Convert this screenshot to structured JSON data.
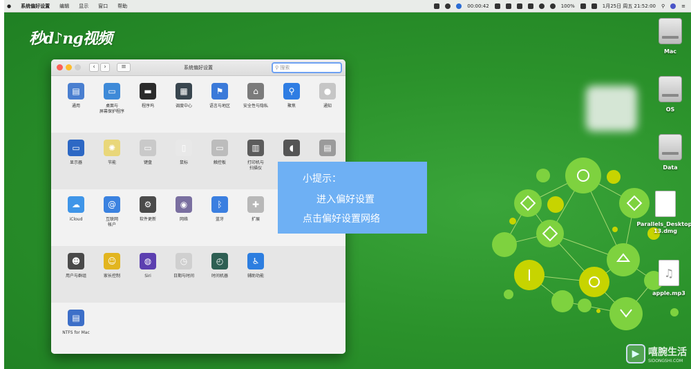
{
  "menubar": {
    "app": "系统偏好设置",
    "menus": [
      "编辑",
      "显示",
      "窗口",
      "帮助"
    ],
    "timer": "00:00:42",
    "battery": "100%",
    "datetime": "1月25日 周五 21:52:00"
  },
  "brand": "秒d♪ng视频",
  "window": {
    "title": "系统偏好设置",
    "search_placeholder": "搜索"
  },
  "rows": [
    [
      {
        "label": "通用",
        "icon": "general-icon",
        "color": "#4a7fd0",
        "glyph": "▤"
      },
      {
        "label": "桌面与\n屏幕保护程序",
        "icon": "desktop-screensaver-icon",
        "color": "#3e8ad8",
        "glyph": "▭"
      },
      {
        "label": "程序坞",
        "icon": "dock-icon",
        "color": "#2b2b2b",
        "glyph": "▬"
      },
      {
        "label": "调度中心",
        "icon": "mission-control-icon",
        "color": "#39464f",
        "glyph": "▦"
      },
      {
        "label": "语言与地区",
        "icon": "language-region-icon",
        "color": "#3b7ad9",
        "glyph": "⚑"
      },
      {
        "label": "安全性与隐私",
        "icon": "security-privacy-icon",
        "color": "#7b7b7b",
        "glyph": "⌂"
      },
      {
        "label": "聚焦",
        "icon": "spotlight-icon",
        "color": "#2f7de3",
        "glyph": "⚲"
      },
      {
        "label": "通知",
        "icon": "notifications-icon",
        "color": "#c6c6c6",
        "glyph": "●"
      }
    ],
    [
      {
        "label": "显示器",
        "icon": "displays-icon",
        "color": "#2d68c4",
        "glyph": "▭"
      },
      {
        "label": "节能",
        "icon": "energy-saver-icon",
        "color": "#e9d77a",
        "glyph": "✺"
      },
      {
        "label": "键盘",
        "icon": "keyboard-icon",
        "color": "#c9c9c9",
        "glyph": "▭"
      },
      {
        "label": "鼠标",
        "icon": "mouse-icon",
        "color": "#e8e8e8",
        "glyph": "▯"
      },
      {
        "label": "触控板",
        "icon": "trackpad-icon",
        "color": "#bcbcbc",
        "glyph": "▭"
      },
      {
        "label": "打印机与\n扫描仪",
        "icon": "printers-scanners-icon",
        "color": "#5c5c5c",
        "glyph": "▥"
      },
      {
        "label": "",
        "icon": "sound-icon",
        "color": "#555555",
        "glyph": "◖"
      },
      {
        "label": "",
        "icon": "startup-disk-icon",
        "color": "#9a9a9a",
        "glyph": "▤"
      }
    ],
    [
      {
        "label": "iCloud",
        "icon": "icloud-icon",
        "color": "#3f95e8",
        "glyph": "☁"
      },
      {
        "label": "互联网\n帐户",
        "icon": "internet-accounts-icon",
        "color": "#3b82e0",
        "glyph": "@"
      },
      {
        "label": "软件更新",
        "icon": "software-update-icon",
        "color": "#4b4b4b",
        "glyph": "⚙"
      },
      {
        "label": "网络",
        "icon": "network-icon",
        "color": "#7a6fa0",
        "glyph": "◉"
      },
      {
        "label": "蓝牙",
        "icon": "bluetooth-icon",
        "color": "#3b7fe0",
        "glyph": "ᛒ"
      },
      {
        "label": "扩展",
        "icon": "extensions-icon",
        "color": "#b8b8b8",
        "glyph": "✚"
      }
    ],
    [
      {
        "label": "用户与群组",
        "icon": "users-groups-icon",
        "color": "#4a4a4a",
        "glyph": "☻"
      },
      {
        "label": "家长控制",
        "icon": "parental-controls-icon",
        "color": "#e2b51f",
        "glyph": "☺"
      },
      {
        "label": "Siri",
        "icon": "siri-icon",
        "color": "#5c3fb0",
        "glyph": "◍"
      },
      {
        "label": "日期与时间",
        "icon": "date-time-icon",
        "color": "#d0d0d0",
        "glyph": "◷"
      },
      {
        "label": "时间机器",
        "icon": "time-machine-icon",
        "color": "#2e5f53",
        "glyph": "◴"
      },
      {
        "label": "辅助功能",
        "icon": "accessibility-icon",
        "color": "#2d7ee0",
        "glyph": "♿"
      }
    ],
    [
      {
        "label": "NTFS for Mac",
        "icon": "ntfs-for-mac-icon",
        "color": "#3d6fc8",
        "glyph": "▤"
      }
    ]
  ],
  "tip": {
    "title": "小提示：",
    "line1": "进入偏好设置",
    "line2": "点击偏好设置网络"
  },
  "desktop": [
    {
      "label": "Mac",
      "icon": "hard-drive-icon",
      "kind": "drive"
    },
    {
      "label": "OS",
      "icon": "hard-drive-icon",
      "kind": "drive"
    },
    {
      "label": "Data",
      "icon": "hard-drive-icon",
      "kind": "drive"
    },
    {
      "label": "Parallels_Desktop-\n13.dmg",
      "icon": "disk-image-icon",
      "kind": "doc"
    },
    {
      "label": "apple.mp3",
      "icon": "music-file-icon",
      "kind": "doc"
    }
  ],
  "watermark": {
    "title": "嘻腕生活",
    "url": "SIDONGSHI.COM"
  }
}
